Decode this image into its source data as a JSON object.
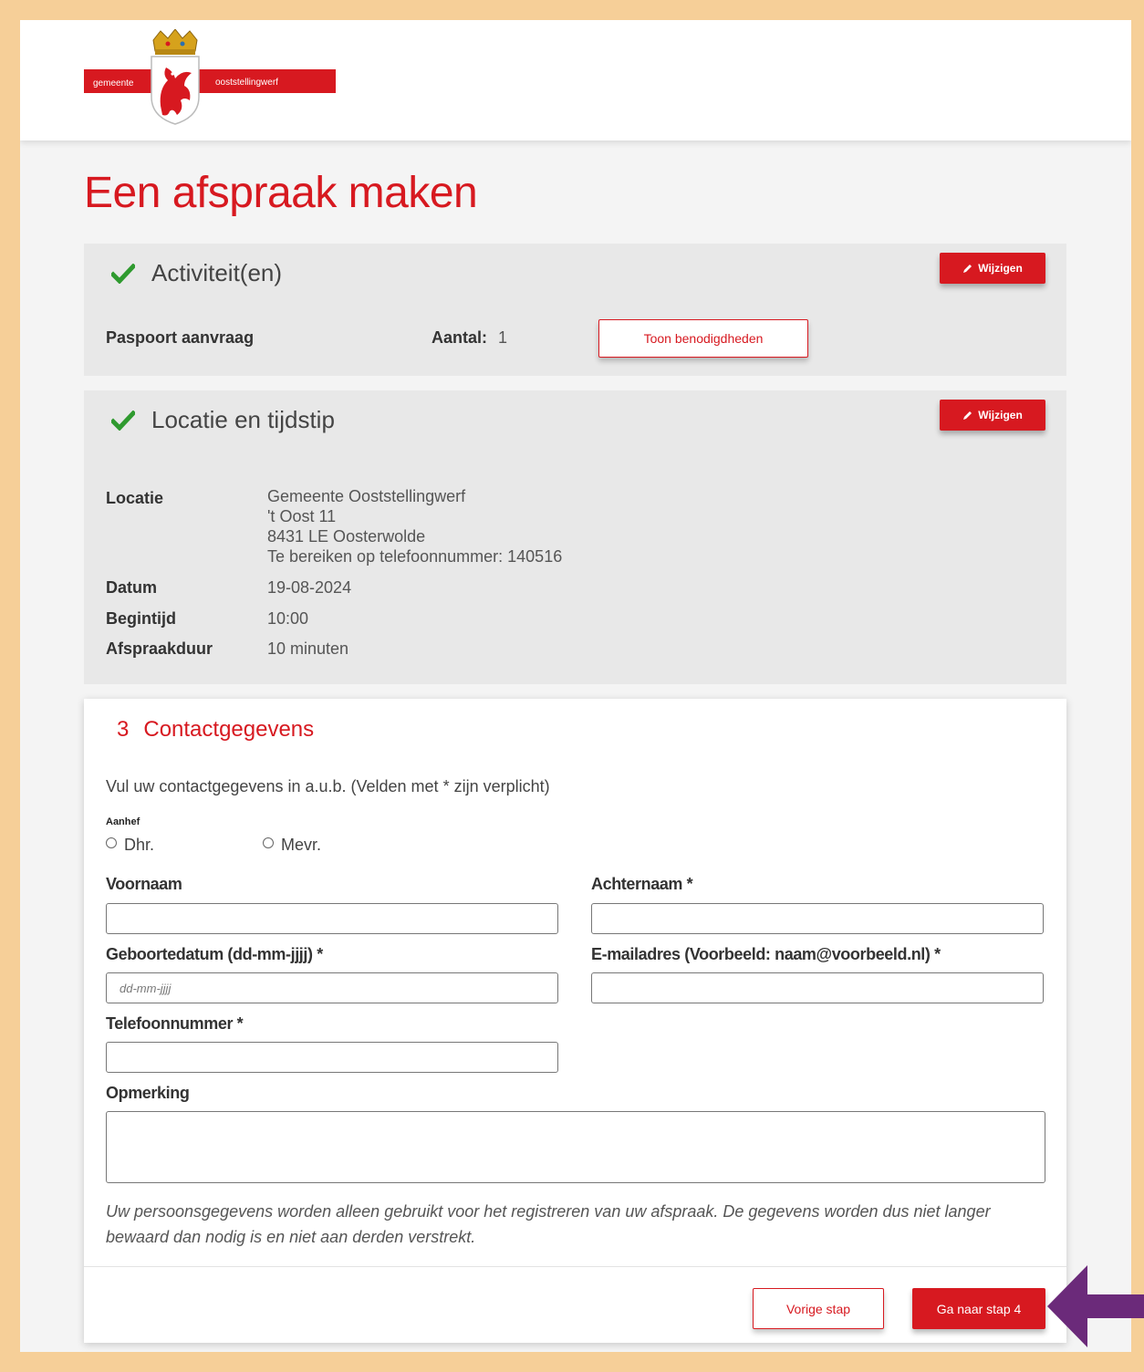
{
  "header": {
    "logo_left": "gemeente",
    "logo_right": "ooststellingwerf"
  },
  "page": {
    "title": "Een afspraak maken"
  },
  "activities": {
    "title": "Activiteit(en)",
    "edit_label": "Wijzigen",
    "item": "Paspoort aanvraag",
    "count_label": "Aantal:",
    "count_value": "1",
    "show_requirements_label": "Toon benodigdheden"
  },
  "location": {
    "title": "Locatie en tijdstip",
    "edit_label": "Wijzigen",
    "location_label": "Locatie",
    "location_lines": [
      "Gemeente Ooststellingwerf",
      "'t Oost 11",
      "8431 LE Oosterwolde",
      "Te bereiken op telefoonnummer: 140516"
    ],
    "date_label": "Datum",
    "date_value": "19-08-2024",
    "start_label": "Begintijd",
    "start_value": "10:00",
    "duration_label": "Afspraakduur",
    "duration_value": "10 minuten"
  },
  "contact": {
    "step": "3",
    "title": "Contactgegevens",
    "intro": "Vul uw contactgegevens in a.u.b. (Velden met * zijn verplicht)",
    "salutation_label": "Aanhef",
    "salutation_options": [
      "Dhr.",
      "Mevr."
    ],
    "first_name_label": "Voornaam",
    "last_name_label": "Achternaam *",
    "birthdate_label": "Geboortedatum (dd-mm-jjjj) *",
    "birthdate_placeholder": "dd-mm-jjjj",
    "email_label": "E-mailadres (Voorbeeld: naam@voorbeeld.nl) *",
    "phone_label": "Telefoonnummer *",
    "remark_label": "Opmerking",
    "privacy_text": "Uw persoonsgegevens worden alleen gebruikt voor het registreren van uw afspraak. De gegevens worden dus niet langer bewaard dan nodig is en niet aan derden verstrekt.",
    "prev_label": "Vorige stap",
    "next_label": "Ga naar stap 4"
  },
  "colors": {
    "brand_red": "#d71920",
    "check_green": "#2f9a2f",
    "frame_orange": "#f6cf98",
    "arrow_purple": "#6b2a7a"
  },
  "icons": {
    "check": "check-icon",
    "edit": "pencil-icon",
    "annotation": "left-arrow-icon"
  }
}
